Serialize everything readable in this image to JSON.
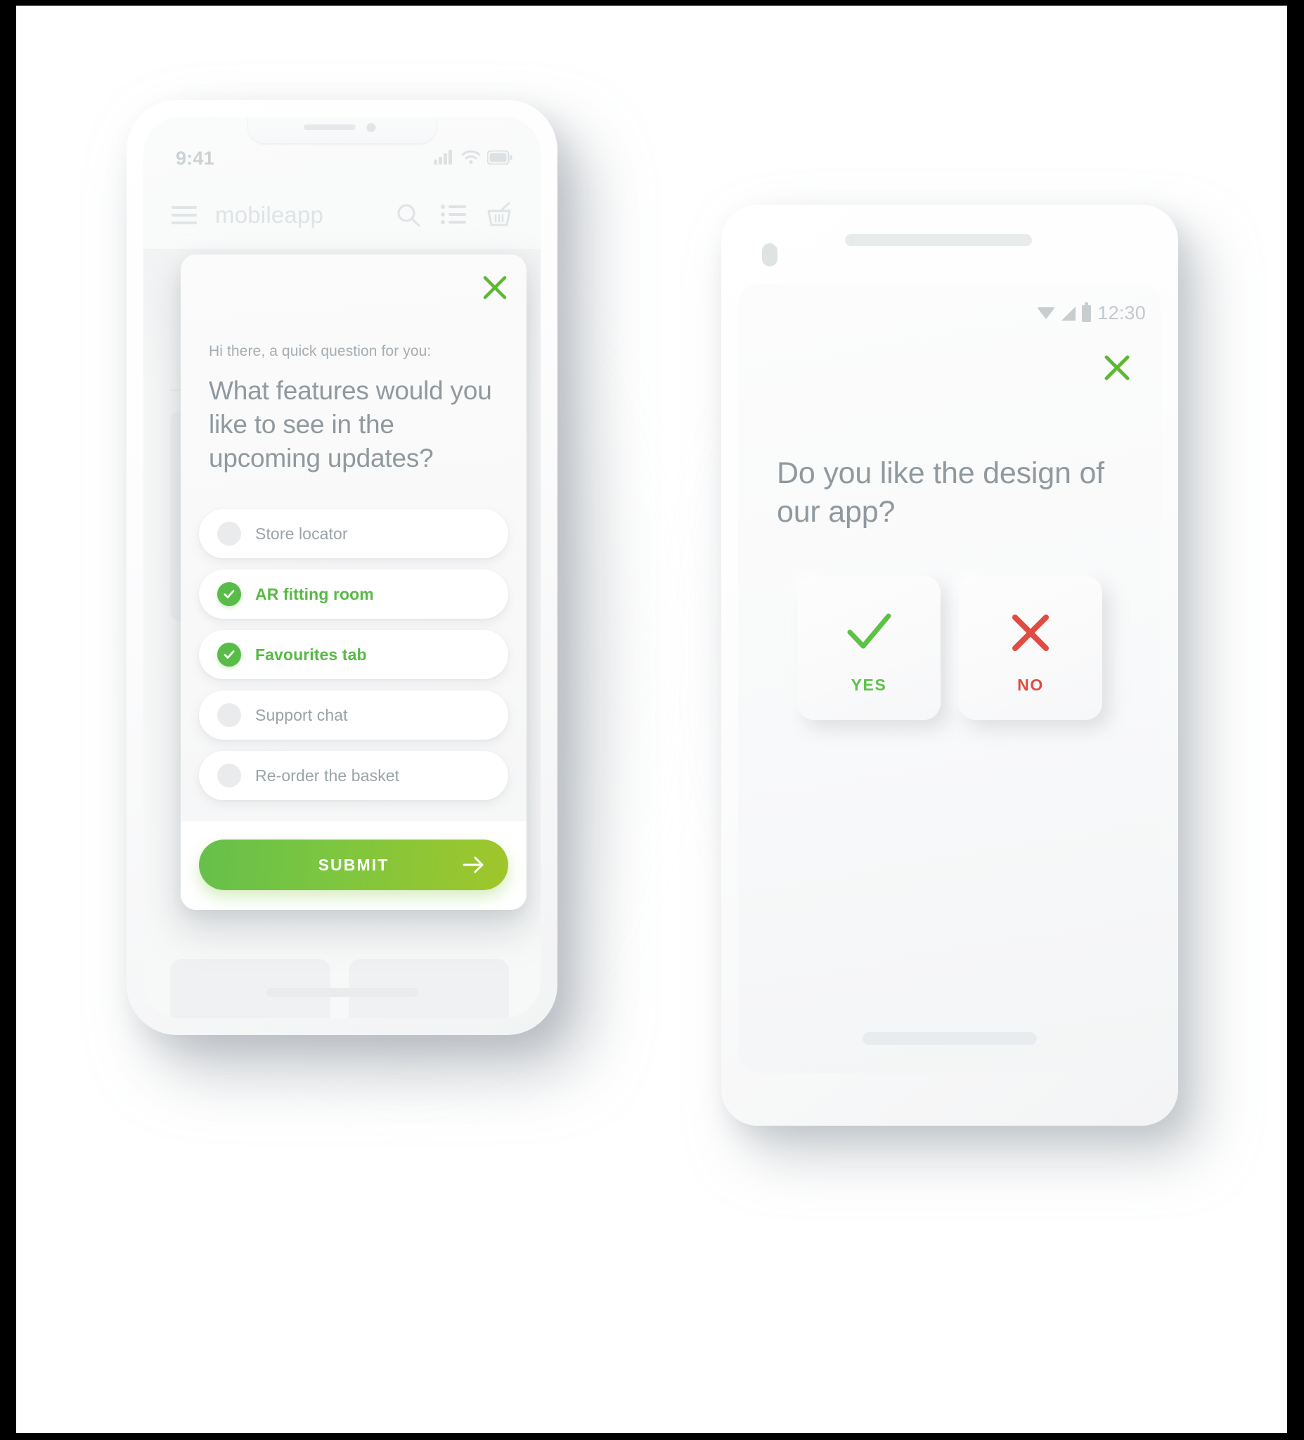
{
  "iphone": {
    "status": {
      "time": "9:41",
      "signal_icon": "cellular-signal-icon",
      "wifi_icon": "wifi-icon",
      "battery_icon": "battery-icon"
    },
    "app_header": {
      "menu_icon": "hamburger-menu-icon",
      "title": "mobileapp",
      "search_icon": "search-icon",
      "list_icon": "list-icon",
      "basket_icon": "shopping-basket-icon"
    },
    "survey": {
      "close_icon": "close-x-icon",
      "intro": "Hi there, a quick question for you:",
      "question": "What features would you like to see in the upcoming updates?",
      "options": [
        {
          "label": "Store locator",
          "selected": false
        },
        {
          "label": "AR fitting room",
          "selected": true
        },
        {
          "label": "Favourites tab",
          "selected": false
        },
        {
          "label": "Support chat",
          "selected": false
        },
        {
          "label": "Re-order the basket",
          "selected": false
        }
      ],
      "options_selected_override": [
        false,
        true,
        true,
        false,
        false
      ],
      "submit_label": "SUBMIT",
      "submit_arrow_icon": "arrow-right-icon"
    },
    "home_indicator": "home-indicator-bar"
  },
  "android": {
    "status": {
      "wifi_icon": "wifi-icon",
      "signal_icon": "cellular-signal-icon",
      "battery_icon": "battery-icon",
      "time": "12:30"
    },
    "survey": {
      "close_icon": "close-x-icon",
      "question": "Do you like the design of our app?",
      "answers": [
        {
          "label": "YES",
          "icon": "checkmark-icon"
        },
        {
          "label": "NO",
          "icon": "cross-x-icon"
        }
      ]
    },
    "home_indicator": "home-indicator-bar"
  },
  "colors": {
    "brand_green": "#59bb48",
    "submit_gradient_start": "#66c04b",
    "submit_gradient_end": "#a0c62a",
    "close_green": "#5cb832",
    "yes_green": "#5cc246",
    "no_red": "#e24b42",
    "text_gray": "#8f999e",
    "muted_gray": "#a5adb2"
  }
}
